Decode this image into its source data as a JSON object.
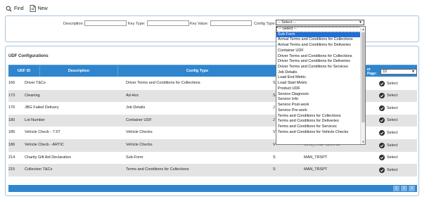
{
  "toolbar": {
    "find_label": "Find",
    "new_label": "New"
  },
  "filters": {
    "description_label": "Description:",
    "key_type_label": "Key Type:",
    "key_value_label": "Key Value:",
    "config_type_label": "Config Type:",
    "config_type_value": "-- Select --"
  },
  "dropdown": {
    "options": [
      "-- Select --",
      "Sub-Form",
      "Arrival Terms and Conditions for Collections",
      "Arrival Terms and Conditions for Deliveries",
      "Container UDF",
      "Driver Terms and Conditions for Collections",
      "Driver Terms and Conditions for Deliveries",
      "Driver Terms and Conditions for Services",
      "Job Details",
      "Load End Metric",
      "Load Start Metric",
      "Product UDF",
      "Service Diagnosis",
      "Service Info",
      "Service Post-work",
      "Service Pre-work",
      "Terms and Conditions for Collections",
      "Terms and Conditions for Deliveries",
      "Terms and Conditions for Services",
      "Terms and Conditions for Vehicle Checks"
    ],
    "selected_index": 1
  },
  "panel": {
    "title": "UDF Configurations"
  },
  "grid": {
    "columns": [
      "UDF ID",
      "Description",
      "Config Type"
    ],
    "page_size_label": "er Page:",
    "page_size_value": "10",
    "select_label": "Select",
    "rows": [
      {
        "id": "166",
        "description": "Driver T&Cs",
        "config_type": "Driver Terms and Conditions for Collections",
        "key_type": "S",
        "key_value": ""
      },
      {
        "id": "173",
        "description": "Cleaning",
        "config_type": "Ad-Hoc",
        "key_type": "S",
        "key_value": ""
      },
      {
        "id": "176",
        "description": "JBG Failed Delivery",
        "config_type": "Job Details",
        "key_type": "J",
        "key_value": ""
      },
      {
        "id": "180",
        "description": "Lot Number",
        "config_type": "Container UDF",
        "key_type": "J",
        "key_value": ""
      },
      {
        "id": "185",
        "description": "Vehicle Check - 7.5T",
        "config_type": "Vehicle Checks",
        "key_type": "V",
        "key_value": ""
      },
      {
        "id": "186",
        "description": "Vehicle Check - ARTIC",
        "config_type": "Vehicle Checks",
        "key_type": "V",
        "key_value": "MAN_TRSPT|ARTIC"
      },
      {
        "id": "214",
        "description": "Charity Gift Aid Declaration",
        "config_type": "Sub-Form",
        "key_type": "S",
        "key_value": "MAN_TRSPT"
      },
      {
        "id": "215",
        "description": "Collection T&Cs",
        "config_type": "Terms and Conditions for Collections",
        "key_type": "S",
        "key_value": "MAN_TRSPT"
      }
    ],
    "pages": [
      "1",
      "2",
      "3"
    ]
  }
}
